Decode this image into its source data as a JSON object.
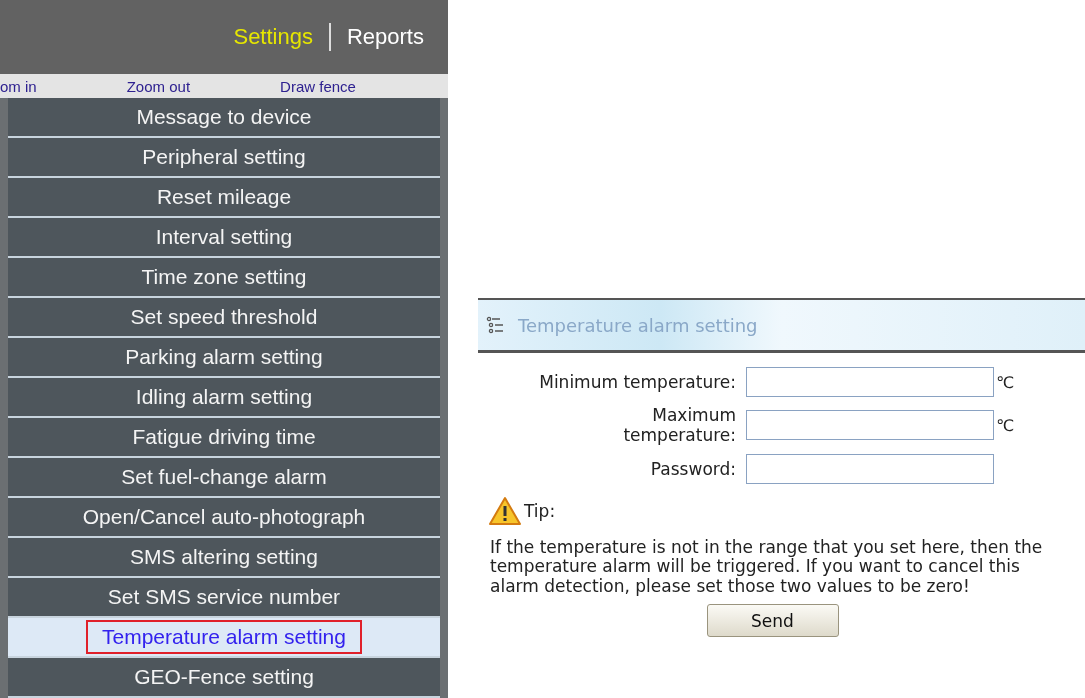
{
  "nav": [
    {
      "label": "Settings",
      "selected": true
    },
    {
      "label": "Reports",
      "selected": false
    }
  ],
  "map_toolbar": [
    "om in",
    "Zoom out",
    "Draw fence"
  ],
  "menu": [
    {
      "label": "Message to device",
      "selected": false
    },
    {
      "label": "Peripheral setting",
      "selected": false
    },
    {
      "label": "Reset mileage",
      "selected": false
    },
    {
      "label": "Interval setting",
      "selected": false
    },
    {
      "label": "Time zone setting",
      "selected": false
    },
    {
      "label": "Set speed threshold",
      "selected": false
    },
    {
      "label": "Parking alarm setting",
      "selected": false
    },
    {
      "label": "Idling alarm setting",
      "selected": false
    },
    {
      "label": "Fatigue driving time",
      "selected": false
    },
    {
      "label": "Set fuel-change alarm",
      "selected": false
    },
    {
      "label": "Open/Cancel auto-photograph",
      "selected": false
    },
    {
      "label": "SMS altering setting",
      "selected": false
    },
    {
      "label": "Set SMS service number",
      "selected": false
    },
    {
      "label": "Temperature alarm setting",
      "selected": true
    },
    {
      "label": "GEO-Fence setting",
      "selected": false
    }
  ],
  "panel": {
    "title": "Temperature alarm setting",
    "fields": [
      {
        "label": "Minimum temperature:",
        "unit": "℃"
      },
      {
        "label": "Maximum temperature:",
        "unit": "℃"
      },
      {
        "label": "Password:"
      }
    ],
    "tip_label": "Tip:",
    "tip_text": "If the temperature is not in the range that you set here, then the temperature alarm will be triggered. If you want to cancel this alarm detection, please set those two values to be zero!",
    "button": "Send"
  }
}
